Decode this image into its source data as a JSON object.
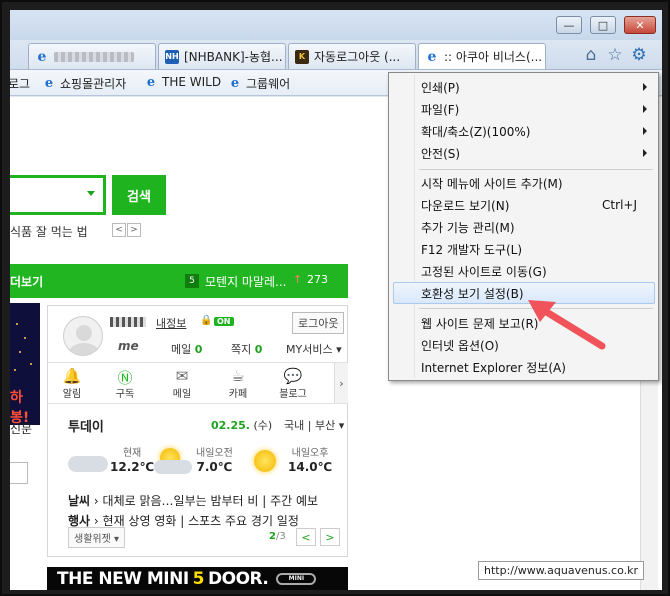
{
  "window": {
    "minimize_label": "—",
    "maximize_label": "□",
    "close_label": "✕"
  },
  "tabs": [
    {
      "label": "",
      "icon": "ie-icon",
      "blurred": true
    },
    {
      "label": "[NHBANK]-농협...",
      "icon": "nh-icon"
    },
    {
      "label": "자동로그아웃 (...",
      "icon": "ks-icon"
    },
    {
      "label": ":: 아쿠아 비너스(...",
      "icon": "ie-icon"
    }
  ],
  "favorites": [
    {
      "label": "로그",
      "icon": "ie-icon"
    },
    {
      "label": "쇼핑몰관리자",
      "icon": "ie-icon"
    },
    {
      "label": "THE WILD",
      "icon": "ie-icon"
    },
    {
      "label": "그룹웨어",
      "icon": "ie-icon"
    }
  ],
  "search": {
    "button_label": "검색",
    "sub_text": "식품 잘 먹는 법",
    "prev": "<",
    "next": ">"
  },
  "greenbar": {
    "left_label": "더보기",
    "rank": "5",
    "news": "모텐지 마말레...",
    "trend": "↑",
    "count": "273"
  },
  "side": {
    "ad_text": "하봉!",
    "text1": "신문"
  },
  "profile": {
    "my_info": "내정보",
    "on_badge": "ON",
    "logout": "로그아웃",
    "me_label": "me",
    "mail_label": "메일",
    "mail_count": "0",
    "note_label": "쪽지",
    "note_count": "0",
    "services_label": "MY서비스"
  },
  "services": [
    {
      "label": "알림",
      "icon": "bell-icon"
    },
    {
      "label": "구독",
      "icon": "subscribe-icon"
    },
    {
      "label": "메일",
      "icon": "mail-icon"
    },
    {
      "label": "카페",
      "icon": "cafe-icon"
    },
    {
      "label": "블로그",
      "icon": "blog-icon"
    }
  ],
  "today": {
    "title": "투데이",
    "date": "02.25.",
    "weekday": "(수)",
    "region_a": "국내",
    "region_b": "부산",
    "weather": [
      {
        "label": "현재",
        "temp": "12.2℃"
      },
      {
        "label": "내일오전",
        "temp": "7.0℃"
      },
      {
        "label": "내일오후",
        "temp": "14.0℃"
      }
    ],
    "line1_tag": "날씨",
    "line1_text": "대체로 맑음…일부는 밤부터 비 | 주간 예보",
    "line2_tag": "행사",
    "line2_text": "현재 상영 영화 | 스포츠 주요 경기 일정",
    "widget_btn": "생활위젯 ▾",
    "page_current": "2",
    "page_total": "/3",
    "prev": "<",
    "next": ">"
  },
  "ad": {
    "text_a": "THE NEW MINI",
    "text_five": "5",
    "text_b": "DOOR.",
    "logo": "MINI"
  },
  "watermark": "http://www.aquavenus.co.kr",
  "menu": {
    "items": [
      {
        "label": "인쇄(P)",
        "submenu": true
      },
      {
        "label": "파일(F)",
        "submenu": true
      },
      {
        "label": "확대/축소(Z)(100%)",
        "submenu": true
      },
      {
        "label": "안전(S)",
        "submenu": true
      },
      {
        "label": "시작 메뉴에 사이트 추가(M)"
      },
      {
        "label": "다운로드 보기(N)",
        "shortcut": "Ctrl+J"
      },
      {
        "label": "추가 기능 관리(M)"
      },
      {
        "label": "F12 개발자 도구(L)"
      },
      {
        "label": "고정된 사이트로 이동(G)"
      },
      {
        "label": "호환성 보기 설정(B)",
        "highlighted": true
      },
      {
        "label": "웹 사이트 문제 보고(R)"
      },
      {
        "label": "인터넷 옵션(O)"
      },
      {
        "label": "Internet Explorer 정보(A)"
      }
    ]
  },
  "colors": {
    "naver_green": "#1fb41f",
    "menu_highlight": "#d9e8fb",
    "arrow_red": "#f0545a"
  }
}
